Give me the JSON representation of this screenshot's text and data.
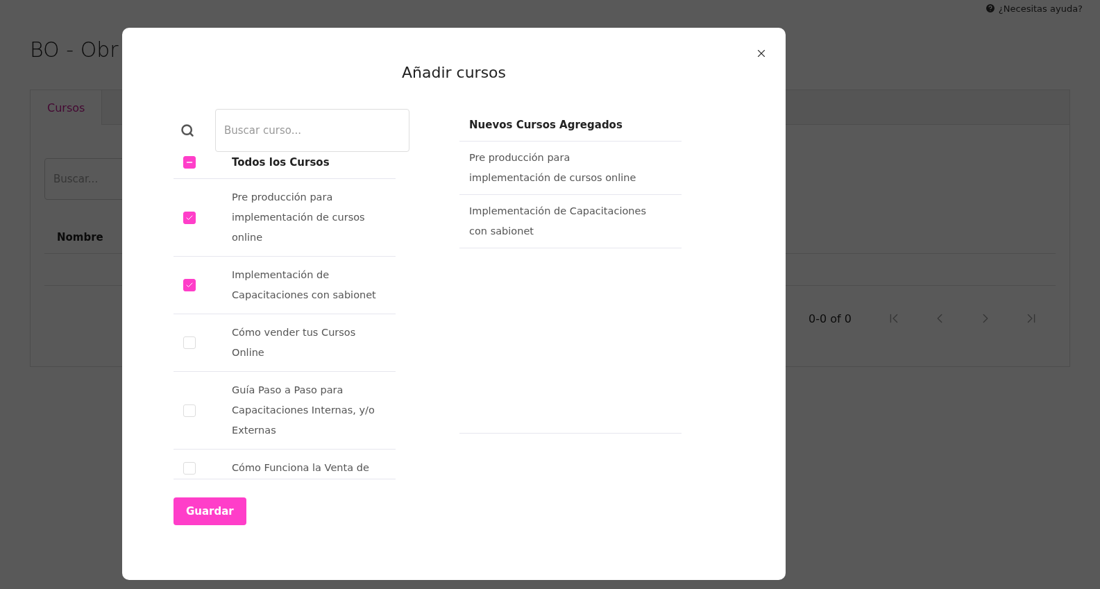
{
  "help_link": "¿Necesitas ayuda?",
  "page_title": "BO - Obr",
  "tabs": [
    {
      "label": "Cursos",
      "selected": true
    }
  ],
  "search": {
    "placeholder": "Buscar..."
  },
  "table": {
    "columns": [
      "Nombre"
    ]
  },
  "pagination": {
    "range": "0-0 of 0"
  },
  "modal": {
    "title": "Añadir cursos",
    "search": {
      "placeholder": "Buscar curso..."
    },
    "select_all": {
      "label": "Todos los Cursos",
      "checked": true,
      "indeterminate": true
    },
    "courses": [
      {
        "name": "Pre producción para implementación de cursos online",
        "checked": true
      },
      {
        "name": "Implementación de Capacitaciones con sabionet",
        "checked": true
      },
      {
        "name": "Cómo vender tus Cursos Online",
        "checked": false
      },
      {
        "name": "Guía Paso a Paso para Capacitaciones Internas, y/o Externas",
        "checked": false
      },
      {
        "name": "Cómo Funciona la Venta de",
        "checked": false
      }
    ],
    "added_title": "Nuevos Cursos Agregados",
    "added": [
      "Pre producción para implementación de cursos online",
      "Implementación de Capacitaciones con sabionet"
    ],
    "save_button": "Guardar"
  }
}
